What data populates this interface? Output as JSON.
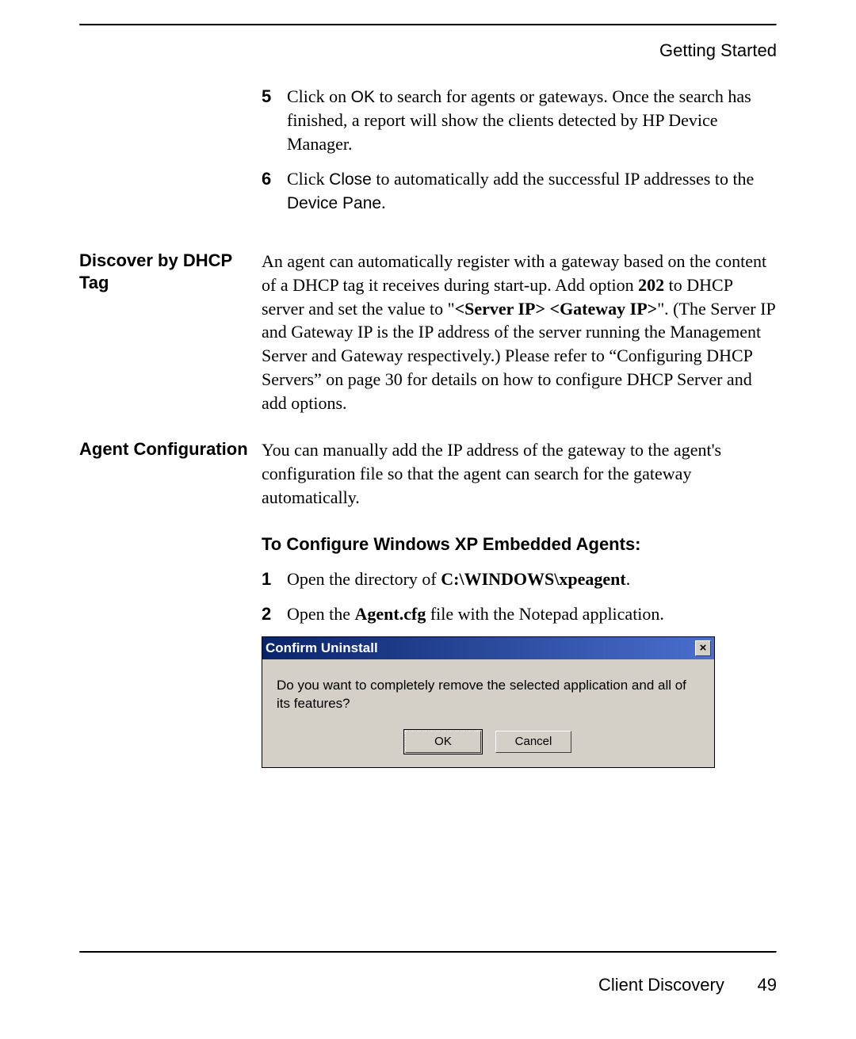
{
  "header": {
    "chapter": "Getting Started"
  },
  "steps_top": [
    {
      "n": "5",
      "pre": "Click on ",
      "uiword": "OK",
      "post": " to search for agents or gateways. Once the search has finished, a report will show the clients detected by HP Device Manager."
    },
    {
      "n": "6",
      "pre": "Click ",
      "uiword": "Close",
      "mid": " to automatically add the successful IP addresses to the ",
      "uiword2": "Device Pane",
      "post": "."
    }
  ],
  "sections": {
    "dhcp": {
      "heading": "Discover by DHCP Tag",
      "text_parts": {
        "p1": "An agent can automatically register with a gateway based on the content of a DHCP tag it receives during start-up. Add option ",
        "bold1": "202",
        "p2": " to DHCP server and set the value to \"",
        "bold2": "<Server IP> <Gateway IP>",
        "p3": "\". (The Server IP and Gateway IP is the IP address of the server running the Management Server and Gateway respectively.) Please refer to “Configuring DHCP Servers” on page 30 for details on how to configure DHCP Server and add options."
      }
    },
    "agent": {
      "heading": "Agent Configuration",
      "intro": "You can manually add the IP address of the gateway to the agent's configuration file so that the agent can search for the gateway automatically.",
      "subheading": "To Configure Windows XP Embedded Agents:",
      "steps": [
        {
          "n": "1",
          "pre": "Open the directory of ",
          "bold": "C:\\WINDOWS\\xpeagent",
          "post": "."
        },
        {
          "n": "2",
          "pre": "Open the ",
          "bold": "Agent.cfg",
          "post": " file with the Notepad application."
        }
      ]
    }
  },
  "dialog": {
    "title": "Confirm Uninstall",
    "message": "Do you want to completely remove the selected application and all of its features?",
    "ok": "OK",
    "cancel": "Cancel",
    "close_glyph": "×"
  },
  "footer": {
    "section": "Client Discovery",
    "page": "49"
  }
}
